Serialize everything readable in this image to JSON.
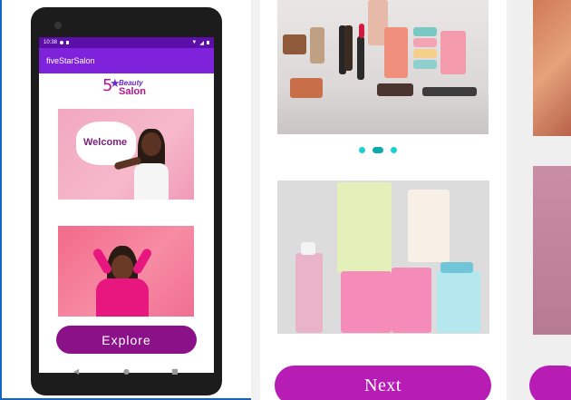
{
  "phone": {
    "status": {
      "time": "10:38"
    },
    "app_title": "fiveStarSalon",
    "logo": {
      "star_text": "5",
      "beauty": "Beauty",
      "salon": "Salon"
    },
    "welcome_text": "Welcome",
    "explore_label": "Explore",
    "nav": {
      "back_icon": "back-triangle",
      "home_icon": "home-circle",
      "recents_icon": "recents-square"
    }
  },
  "onboarding": {
    "carousel": {
      "page_count": 3,
      "active_index": 1
    },
    "next_label": "Next"
  },
  "colors": {
    "status_bar": "#5b0fa8",
    "app_bar": "#7e22dc",
    "explore_button": "#8b1189",
    "next_button": "#b71db5",
    "indicator": "#18d2d2"
  }
}
